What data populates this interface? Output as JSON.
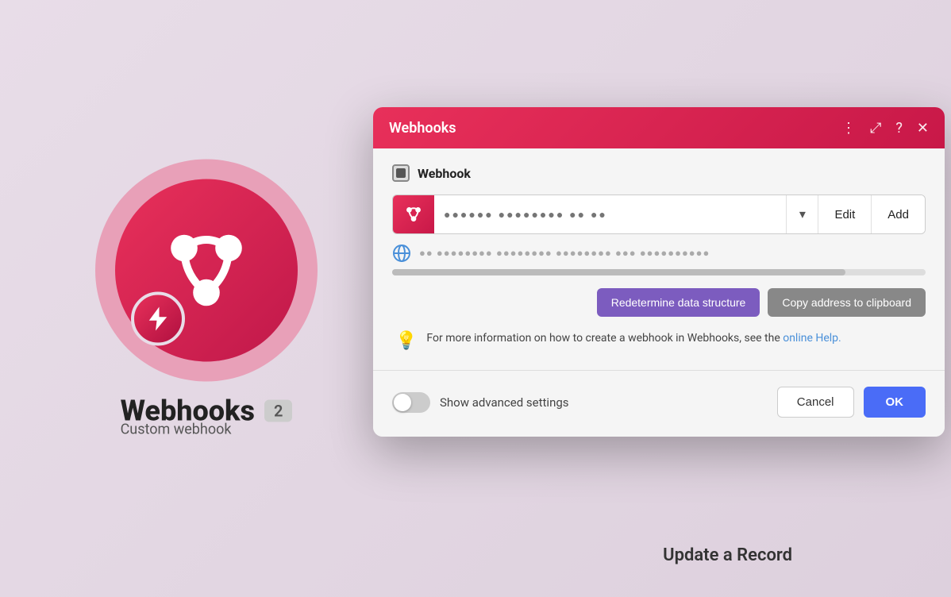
{
  "background": {
    "app_title": "Webhooks",
    "app_badge": "2",
    "app_subtitle": "Custom webhook",
    "bottom_text": "Update a Record"
  },
  "modal": {
    "title": "Webhooks",
    "section_title": "Webhook",
    "webhook_url_placeholder": "●●●●●● ●●●●●●●● ●● ●●",
    "edit_button": "Edit",
    "add_button": "Add",
    "url_display": "●● ●●●●●●●● ●●●●●●●● ●●●●●●●● ●●● ●●●●●●●●●●",
    "redetermine_button": "Redetermine data structure",
    "copy_clipboard_button": "Copy address to clipboard",
    "info_text": "For more information on how to create a webhook in Webhooks, see the ",
    "info_link_text": "online Help.",
    "toggle_label": "Show advanced settings",
    "cancel_button": "Cancel",
    "ok_button": "OK"
  },
  "icons": {
    "more_icon": "⋮",
    "expand_icon": "⤢",
    "help_icon": "?",
    "close_icon": "✕",
    "dropdown_icon": "▾",
    "bulb_icon": "💡"
  },
  "colors": {
    "brand_gradient_start": "#e8305a",
    "brand_gradient_end": "#c81848",
    "purple_button": "#7c5cbf",
    "gray_button": "#888888",
    "blue_button": "#4a6cf7",
    "link_color": "#4a90d9"
  }
}
